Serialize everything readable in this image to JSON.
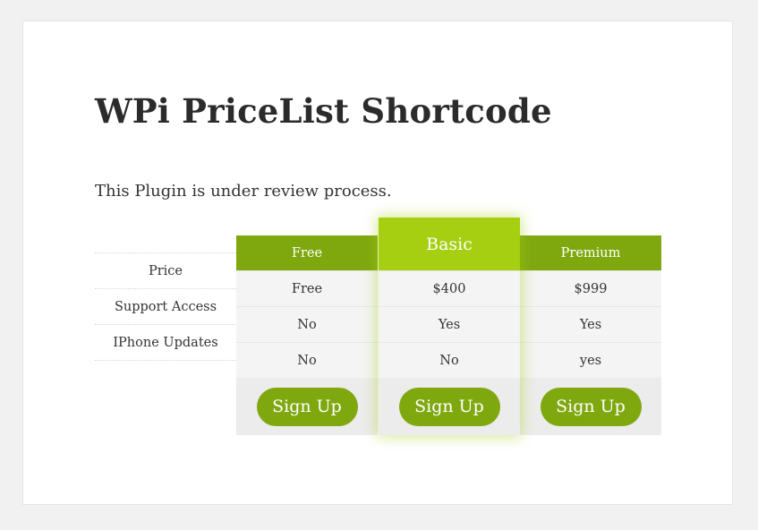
{
  "page": {
    "title": "WPi PriceList Shortcode",
    "description": "This Plugin is under review process."
  },
  "pricing_table": {
    "row_labels": [
      "Price",
      "Support Access",
      "IPhone Updates"
    ],
    "plans": [
      {
        "name": "Free",
        "values": [
          "Free",
          "No",
          "No"
        ],
        "button": "Sign Up",
        "featured": false
      },
      {
        "name": "Basic",
        "values": [
          "$400",
          "Yes",
          "No"
        ],
        "button": "Sign Up",
        "featured": true
      },
      {
        "name": "Premium",
        "values": [
          "$999",
          "Yes",
          "yes"
        ],
        "button": "Sign Up",
        "featured": false
      }
    ]
  },
  "colors": {
    "accent": "#7fa80f",
    "featured_accent": "#a6cf12",
    "cell_background": "#f4f4f4"
  }
}
